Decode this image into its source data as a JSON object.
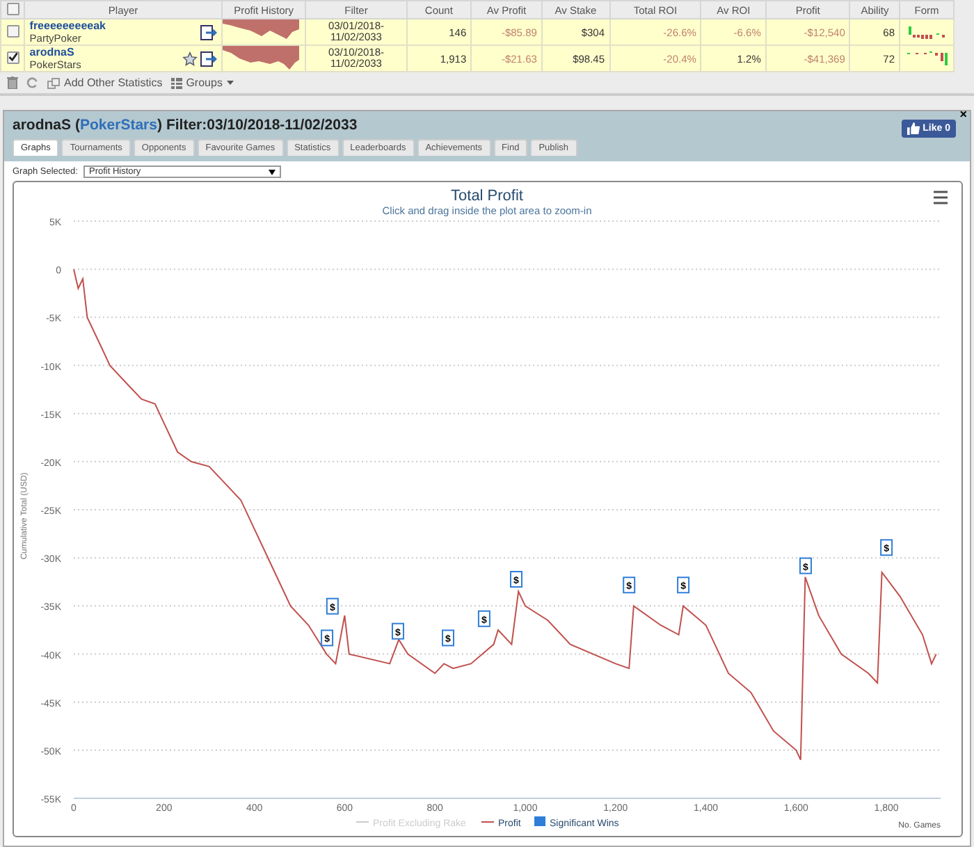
{
  "players_table": {
    "all_selected": false,
    "columns": [
      "Player",
      "Profit History",
      "Filter",
      "Count",
      "Av Profit",
      "Av Stake",
      "Total ROI",
      "Av ROI",
      "Profit",
      "Ability",
      "Form"
    ],
    "rows": [
      {
        "selected": false,
        "cells": [
          {
            "kind": "player",
            "name": "freeeeeeeeeak",
            "site": "PartyPoker",
            "starred": false
          },
          {
            "kind": "sparkline"
          },
          {
            "kind": "dates",
            "text": "03/01/2018-11/02/2033"
          },
          {
            "kind": "number",
            "text": "146",
            "negative": false
          },
          {
            "kind": "number",
            "text": "-$85.89",
            "negative": true
          },
          {
            "kind": "number",
            "text": "$304",
            "negative": false
          },
          {
            "kind": "number",
            "text": "-26.6%",
            "negative": true
          },
          {
            "kind": "number",
            "text": "-6.6%",
            "negative": true
          },
          {
            "kind": "number",
            "text": "-$12,540",
            "negative": true
          },
          {
            "kind": "number",
            "text": "68",
            "negative": false
          },
          {
            "kind": "form"
          }
        ]
      },
      {
        "selected": true,
        "cells": [
          {
            "kind": "player",
            "name": "arodnaS",
            "site": "PokerStars",
            "starred": true
          },
          {
            "kind": "sparkline"
          },
          {
            "kind": "dates",
            "text": "03/10/2018-11/02/2033"
          },
          {
            "kind": "number",
            "text": "1,913",
            "negative": false
          },
          {
            "kind": "number",
            "text": "-$21.63",
            "negative": true
          },
          {
            "kind": "number",
            "text": "$98.45",
            "negative": false
          },
          {
            "kind": "number",
            "text": "-20.4%",
            "negative": true
          },
          {
            "kind": "number",
            "text": "1.2%",
            "negative": false
          },
          {
            "kind": "number",
            "text": "-$41,369",
            "negative": true
          },
          {
            "kind": "number",
            "text": "72",
            "negative": false
          },
          {
            "kind": "form"
          }
        ]
      }
    ]
  },
  "toolbar": {
    "add_stats": "Add Other Statistics",
    "groups": "Groups"
  },
  "panel": {
    "player": "arodnaS",
    "paren_open": "(",
    "site": "PokerStars",
    "paren_close": ")",
    "filter": "Filter:03/10/2018-11/02/2033",
    "like": "Like 0",
    "close": "×",
    "tabs": [
      {
        "label": "Graphs",
        "selected": true
      },
      {
        "label": "Tournaments",
        "selected": false
      },
      {
        "label": "Opponents",
        "selected": false
      },
      {
        "label": "Favourite Games",
        "selected": false
      },
      {
        "label": "Statistics",
        "selected": false
      },
      {
        "label": "Leaderboards",
        "selected": false
      },
      {
        "label": "Achievements",
        "selected": false
      },
      {
        "label": "Find",
        "selected": false
      },
      {
        "label": "Publish",
        "selected": false
      }
    ],
    "graph_label": "Graph Selected:",
    "graph_value": "Profit History",
    "subtitle": "Click and drag inside the plot area to zoom-in",
    "legend": [
      {
        "label": "Profit Excluding Rake",
        "color": "#cccccc",
        "enabled": false
      },
      {
        "label": "Significant Wins",
        "color": "#2f7ed8",
        "enabled": true
      }
    ],
    "chart_data": {
      "type": "line",
      "title": "Total Profit",
      "xlabel": "No. Games",
      "ylabel": "Cumulative Total (USD)",
      "grid": true,
      "xlim": [
        0,
        1920
      ],
      "ylim": [
        -55000,
        5000
      ],
      "xticks": [
        {
          "value": 0,
          "label": "0"
        },
        {
          "value": 200,
          "label": "200"
        },
        {
          "value": 400,
          "label": "400"
        },
        {
          "value": 600,
          "label": "600"
        },
        {
          "value": 800,
          "label": "800"
        },
        {
          "value": 1000,
          "label": "1,000"
        },
        {
          "value": 1200,
          "label": "1,200"
        },
        {
          "value": 1400,
          "label": "1,400"
        },
        {
          "value": 1600,
          "label": "1,600"
        },
        {
          "value": 1800,
          "label": "1,800"
        }
      ],
      "yticks": [
        {
          "value": 5000,
          "label": "5K"
        },
        {
          "value": 0,
          "label": "0"
        },
        {
          "value": -5000,
          "label": "-5K"
        },
        {
          "value": -10000,
          "label": "-10K"
        },
        {
          "value": -15000,
          "label": "-15K"
        },
        {
          "value": -20000,
          "label": "-20K"
        },
        {
          "value": -25000,
          "label": "-25K"
        },
        {
          "value": -30000,
          "label": "-30K"
        },
        {
          "value": -35000,
          "label": "-35K"
        },
        {
          "value": -40000,
          "label": "-40K"
        },
        {
          "value": -45000,
          "label": "-45K"
        },
        {
          "value": -50000,
          "label": "-50K"
        },
        {
          "value": -55000,
          "label": "-55K"
        }
      ],
      "x": [
        0,
        10,
        20,
        30,
        60,
        80,
        120,
        150,
        180,
        200,
        230,
        260,
        300,
        330,
        370,
        400,
        440,
        480,
        520,
        560,
        580,
        600,
        610,
        700,
        720,
        740,
        800,
        820,
        840,
        880,
        930,
        940,
        970,
        985,
        1000,
        1050,
        1100,
        1200,
        1230,
        1240,
        1300,
        1340,
        1350,
        1400,
        1450,
        1500,
        1550,
        1600,
        1610,
        1620,
        1650,
        1700,
        1760,
        1780,
        1790,
        1830,
        1880,
        1900,
        1910
      ],
      "series": [
        {
          "name": "Profit",
          "color": "#c0504d",
          "values": [
            0,
            -2000,
            -1000,
            -5000,
            -8000,
            -10000,
            -12000,
            -13500,
            -14000,
            -16000,
            -19000,
            -20000,
            -20500,
            -22000,
            -24000,
            -27000,
            -31000,
            -35000,
            -37000,
            -40000,
            -41000,
            -36000,
            -40000,
            -41000,
            -38500,
            -40000,
            -42000,
            -41000,
            -41500,
            -41000,
            -39000,
            -37500,
            -39000,
            -33500,
            -35000,
            -36500,
            -39000,
            -41000,
            -41500,
            -35000,
            -37000,
            -38000,
            -35000,
            -37000,
            -42000,
            -44000,
            -48000,
            -50000,
            -51000,
            -32000,
            -36000,
            -40000,
            -42000,
            -43000,
            -31500,
            -34000,
            -38000,
            -41000,
            -40000
          ]
        }
      ],
      "annotations": [
        {
          "x": 561,
          "y": -38400,
          "text": "$"
        },
        {
          "x": 573,
          "y": -35100,
          "text": "$"
        },
        {
          "x": 718,
          "y": -37700,
          "text": "$"
        },
        {
          "x": 829,
          "y": -38400,
          "text": "$"
        },
        {
          "x": 909,
          "y": -36400,
          "text": "$"
        },
        {
          "x": 980,
          "y": -32300,
          "text": "$"
        },
        {
          "x": 1230,
          "y": -32900,
          "text": "$"
        },
        {
          "x": 1350,
          "y": -32900,
          "text": "$"
        },
        {
          "x": 1621,
          "y": -30900,
          "text": "$"
        },
        {
          "x": 1800,
          "y": -29000,
          "text": "$"
        }
      ]
    }
  }
}
